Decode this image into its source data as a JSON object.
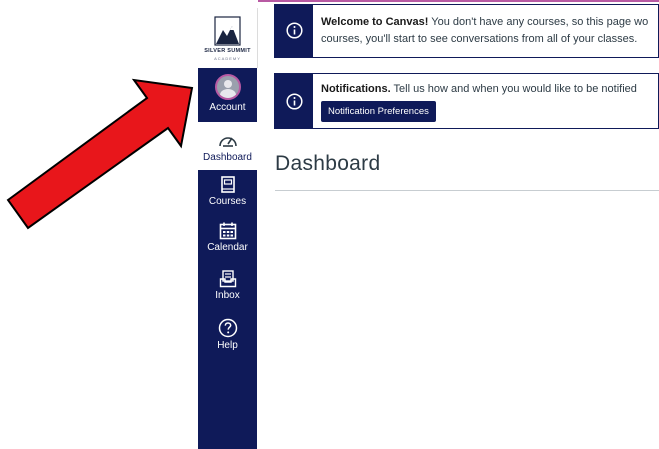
{
  "logo": {
    "name": "SILVER SUMMIT",
    "sub": "ACADEMY"
  },
  "nav": [
    {
      "label": "Account",
      "icon": "user-avatar"
    },
    {
      "label": "Dashboard",
      "icon": "speedometer-icon"
    },
    {
      "label": "Courses",
      "icon": "book-icon"
    },
    {
      "label": "Calendar",
      "icon": "calendar-icon"
    },
    {
      "label": "Inbox",
      "icon": "inbox-icon"
    },
    {
      "label": "Help",
      "icon": "question-icon"
    }
  ],
  "banners": [
    {
      "title": "Welcome to Canvas!",
      "line1": " You don't have any courses, so this page wo",
      "line2": "courses, you'll start to see conversations from all of your classes."
    },
    {
      "title": "Notifications.",
      "line1": " Tell us how and when you would like to be notified",
      "button": "Notification Preferences"
    }
  ],
  "page_title": "Dashboard",
  "colors": {
    "nav_bg": "#0f1a59",
    "accent": "#b85aa3",
    "arrow": "#e8161b"
  }
}
